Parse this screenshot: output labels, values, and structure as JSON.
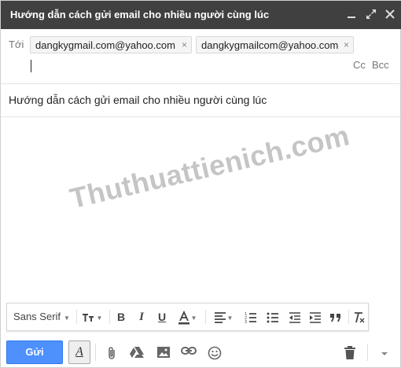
{
  "window": {
    "title": "Hướng dẫn cách gửi email cho nhiều người cùng lúc",
    "controls": [
      "minimize-icon",
      "popout-icon",
      "close-icon"
    ]
  },
  "recipients": {
    "label": "Tới",
    "chips": [
      {
        "email": "dangkygmail.com@yahoo.com",
        "remove": "×"
      },
      {
        "email": "dangkygmailcom@yahoo.com",
        "remove": "×"
      }
    ],
    "cc_label": "Cc",
    "bcc_label": "Bcc"
  },
  "subject": {
    "value": "Hướng dẫn cách gửi email cho nhiều người cùng lúc"
  },
  "body": {
    "watermark": "Thuthuattienich.com"
  },
  "format_toolbar": {
    "font": "Sans Serif",
    "size_icon": "text-size-icon",
    "bold": "B",
    "italic": "I",
    "underline": "U",
    "text_color_icon": "text-color-icon",
    "align_icon": "align-icon",
    "numbered_list_icon": "numbered-list-icon",
    "bulleted_list_icon": "bulleted-list-icon",
    "indent_less_icon": "indent-less-icon",
    "indent_more_icon": "indent-more-icon",
    "quote_icon": "quote-icon",
    "clear_format_icon": "clear-formatting-icon"
  },
  "bottom_bar": {
    "send_label": "Gửi",
    "format_toggle": "A",
    "icons": [
      "attach-icon",
      "drive-icon",
      "photo-icon",
      "link-icon",
      "emoji-icon",
      "trash-icon",
      "more-options-icon"
    ]
  },
  "colors": {
    "titlebar": "#404040",
    "send_button": "#4d90fe"
  }
}
